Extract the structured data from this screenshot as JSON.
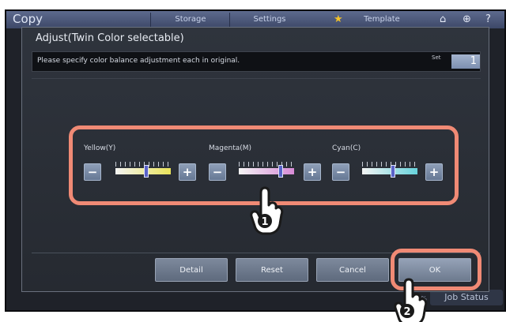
{
  "background_screen": {
    "app_title": "Copy",
    "tabs": [
      "Storage",
      "Settings",
      "Template"
    ],
    "job_status": "Job Status",
    "small_text": "0%"
  },
  "dialog": {
    "title": "Adjust(Twin Color selectable)",
    "info": "Please specify color balance adjustment each in original.",
    "set_label": "Set",
    "set_value": "1"
  },
  "adjustments": [
    {
      "label": "Yellow(Y)",
      "minus": "−",
      "plus": "+",
      "level": 0.55,
      "color": "#e9e35a"
    },
    {
      "label": "Magenta(M)",
      "minus": "−",
      "plus": "+",
      "level": 0.75,
      "color": "#d78ad6"
    },
    {
      "label": "Cyan(C)",
      "minus": "−",
      "plus": "+",
      "level": 0.55,
      "color": "#67d3dc"
    }
  ],
  "buttons": {
    "detail": "Detail",
    "reset": "Reset",
    "cancel": "Cancel",
    "ok": "OK"
  },
  "annotations": {
    "step1": "1",
    "step2": "2",
    "highlight_color": "#f08a75"
  }
}
